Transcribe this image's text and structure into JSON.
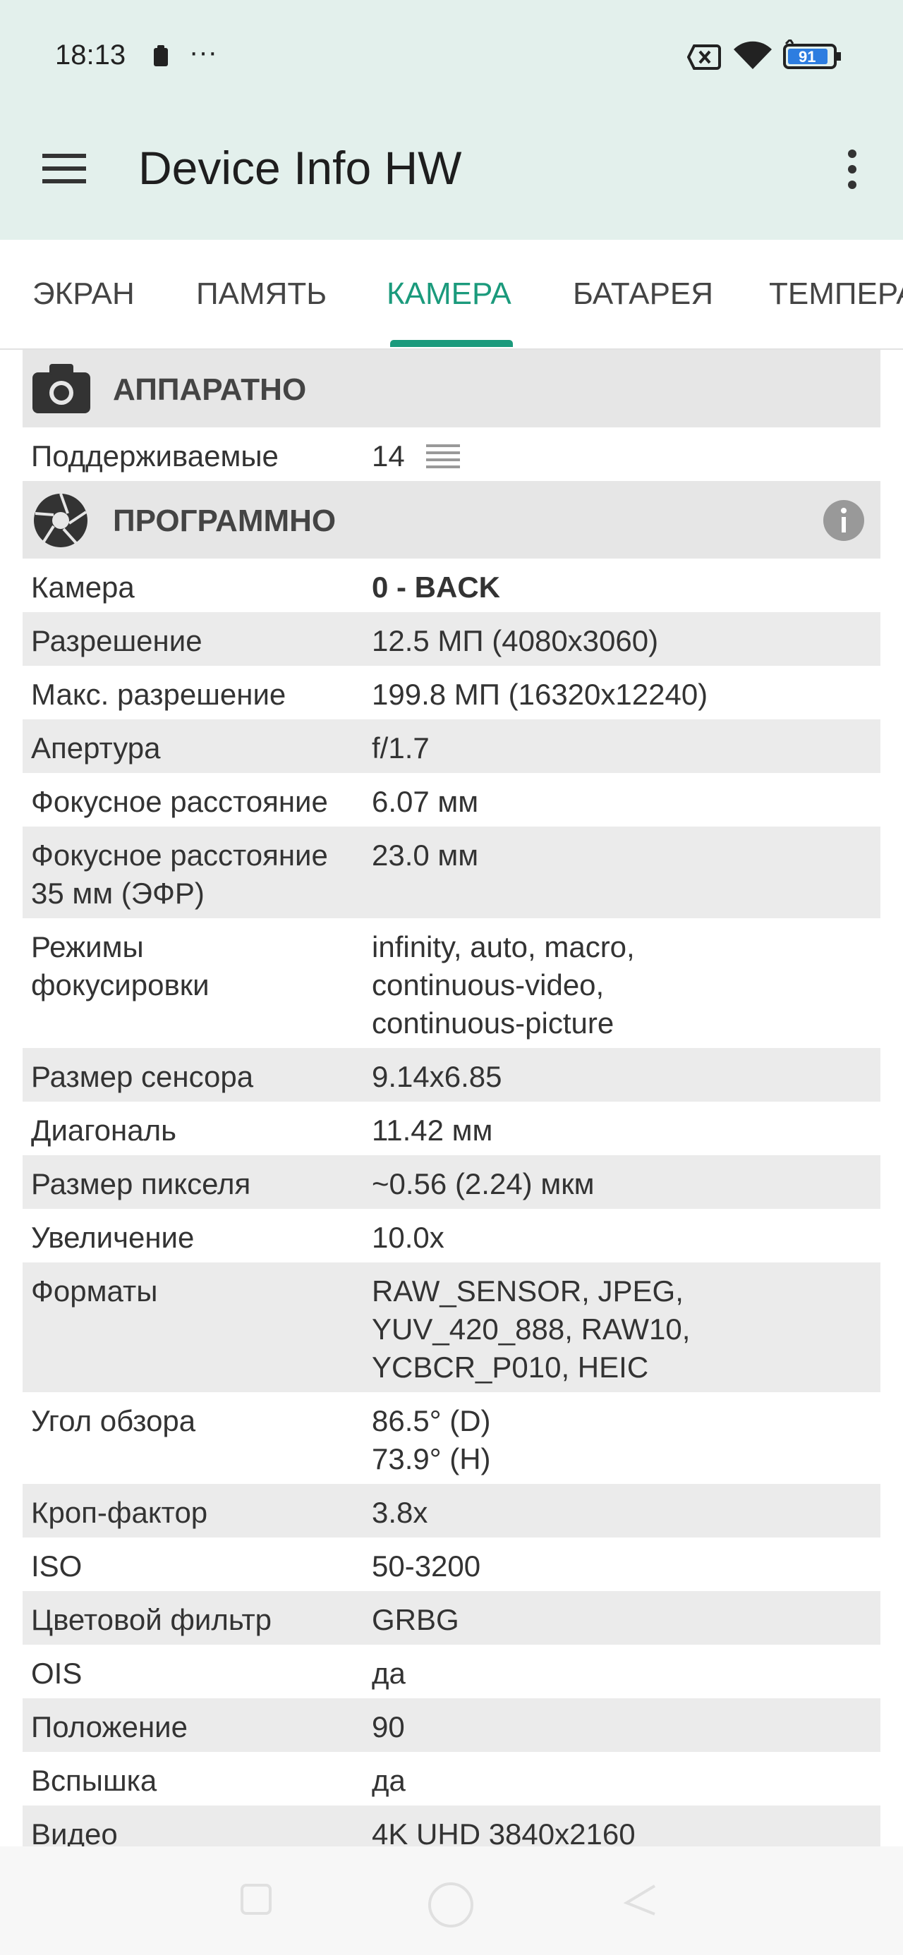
{
  "status_bar": {
    "time": "18:13",
    "more": "···",
    "battery_level": "91"
  },
  "app_bar": {
    "title": "Device Info HW"
  },
  "tabs": [
    {
      "label": "ЭКРАН"
    },
    {
      "label": "ПАМЯТЬ"
    },
    {
      "label": "КАМЕРА"
    },
    {
      "label": "БАТАРЕЯ"
    },
    {
      "label": "ТЕМПЕРА"
    }
  ],
  "hardware": {
    "header": "АППАРАТНО",
    "supported_label": "Поддерживаемые",
    "supported_value": "14"
  },
  "software": {
    "header": "ПРОГРАММНО",
    "rows": [
      {
        "key": "Камера",
        "value": "0 - BACK"
      },
      {
        "key": "Разрешение",
        "value": "12.5 МП (4080x3060)"
      },
      {
        "key": "Макс. разрешение",
        "value": "199.8 МП (16320x12240)"
      },
      {
        "key": "Апертура",
        "value": "f/1.7"
      },
      {
        "key": "Фокусное расстояние",
        "value": "6.07 мм"
      },
      {
        "key": "Фокусное расстояние 35 мм (ЭФР)",
        "value": "23.0 мм"
      },
      {
        "key": "Режимы фокусировки",
        "value": "infinity, auto, macro, continuous-video, continuous-picture"
      },
      {
        "key": "Размер сенсора",
        "value": "9.14x6.85"
      },
      {
        "key": "Диагональ",
        "value": "11.42 мм"
      },
      {
        "key": "Размер пикселя",
        "value": "~0.56 (2.24) мкм"
      },
      {
        "key": "Увеличение",
        "value": "10.0x"
      },
      {
        "key": "Форматы",
        "value": "RAW_SENSOR, JPEG, YUV_420_888, RAW10, YCBCR_P010, HEIC"
      },
      {
        "key": "Угол обзора",
        "value": "86.5° (D)\n73.9° (H)"
      },
      {
        "key": "Кроп-фактор",
        "value": "3.8x"
      },
      {
        "key": "ISO",
        "value": "50-3200"
      },
      {
        "key": "Цветовой фильтр",
        "value": "GRBG"
      },
      {
        "key": "OIS",
        "value": "да"
      },
      {
        "key": "Положение",
        "value": "90"
      },
      {
        "key": "Вспышка",
        "value": "да"
      },
      {
        "key": "Видео",
        "value": "4K UHD 3840x2160"
      }
    ]
  },
  "colors": {
    "accent": "#1b9a7c",
    "app_bar_bg": "#e3f0ec",
    "section_bg": "#e6e6e6"
  }
}
